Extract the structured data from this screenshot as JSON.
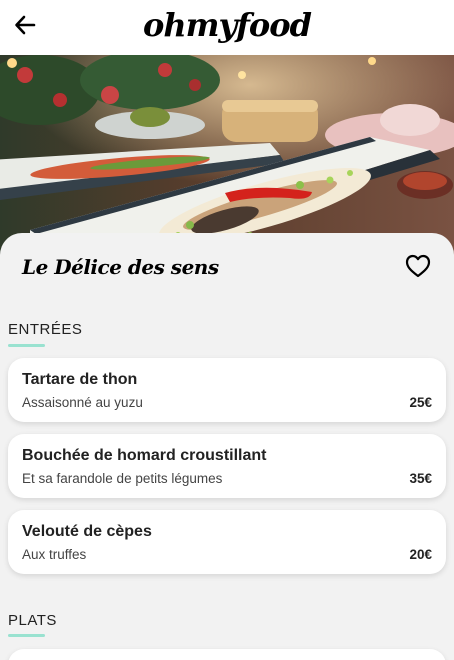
{
  "header": {
    "brand": "ohmyfood",
    "back_icon": "arrow-left-icon"
  },
  "hero": {
    "image_subject": "plated fish dish on long platter in restaurant"
  },
  "restaurant": {
    "name": "Le Délice des sens",
    "favorite_icon": "heart-outline-icon"
  },
  "sections": [
    {
      "title": "ENTRÉES",
      "dishes": [
        {
          "name": "Tartare de thon",
          "description": "Assaisonné au yuzu",
          "price": "25€"
        },
        {
          "name": "Bouchée de homard croustillant",
          "description": "Et sa farandole de petits légumes",
          "price": "35€"
        },
        {
          "name": "Velouté de cèpes",
          "description": "Aux truffes",
          "price": "20€"
        }
      ]
    },
    {
      "title": "PLATS",
      "dishes": []
    }
  ],
  "colors": {
    "accent": "#99e2d0",
    "background": "#f2f2f2",
    "card": "#ffffff"
  }
}
